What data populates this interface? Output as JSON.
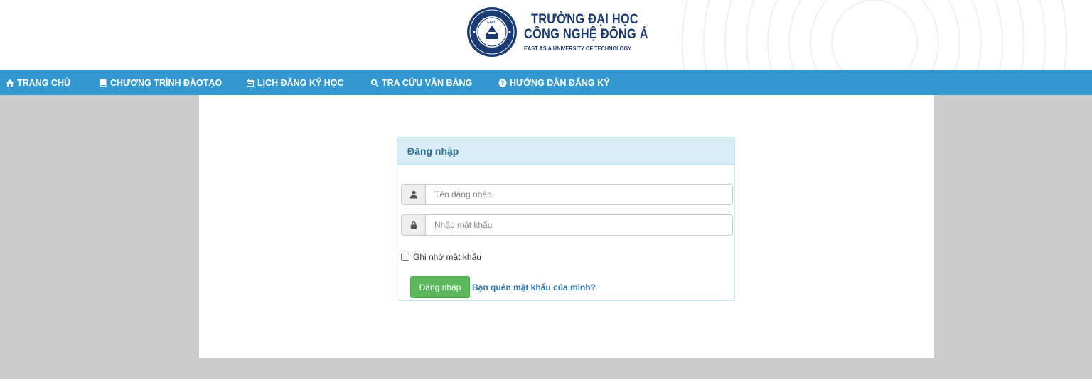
{
  "header": {
    "school_name_line1": "TRƯỜNG ĐẠI HỌC",
    "school_name_line2": "CÔNG NGHỆ ĐÔNG Á",
    "school_name_en": "EAST ASIA UNIVERSITY OF TECHNOLOGY",
    "seal_text": "EAUT",
    "brand_color": "#1c3b73"
  },
  "nav": {
    "background": "#3398cf",
    "items": [
      {
        "label": "TRANG CHỦ",
        "icon": "home-icon"
      },
      {
        "label": "CHƯƠNG TRÌNH ĐÀOTẠO",
        "icon": "book-icon"
      },
      {
        "label": "LỊCH ĐĂNG KÝ HỌC",
        "icon": "calendar-icon"
      },
      {
        "label": "TRA CỨU VĂN BẰNG",
        "icon": "search-icon"
      },
      {
        "label": "HƯỚNG DẪN ĐĂNG KÝ",
        "icon": "question-circle-icon"
      }
    ]
  },
  "login": {
    "title": "Đăng nhập",
    "username": {
      "placeholder": "Tên đăng nhập",
      "value": "",
      "icon": "user-icon"
    },
    "password": {
      "placeholder": "Nhập mật khẩu",
      "value": "",
      "icon": "lock-icon"
    },
    "remember_label": "Ghi nhớ mật khẩu",
    "remember_checked": false,
    "submit_label": "Đăng nhập",
    "forgot_label": "Bạn quên mật khẩu của mình?",
    "submit_color": "#5cb85c",
    "link_color": "#337ab7"
  }
}
